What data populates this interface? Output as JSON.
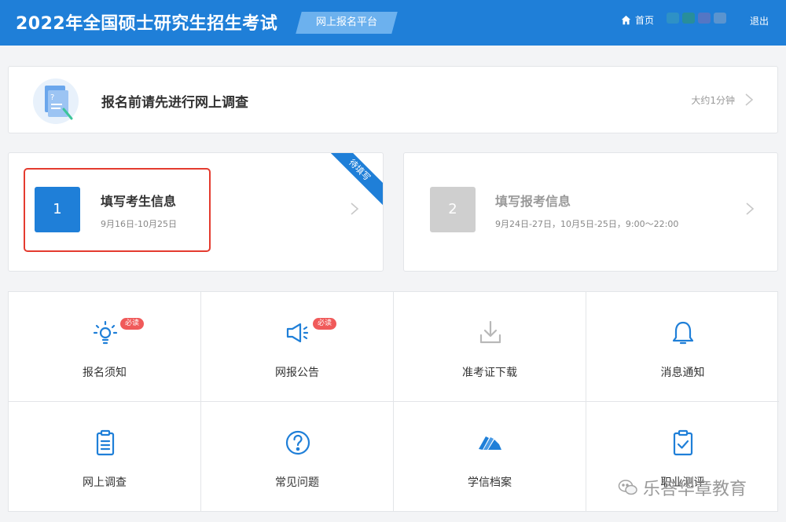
{
  "header": {
    "title": "2022年全国硕士研究生招生考试",
    "platform": "网上报名平台",
    "home_label": "首页",
    "logout_label": "退出",
    "blurred_colors": [
      "#3aa0b8",
      "#2f9a6a",
      "#7f6fb5",
      "#8aa5c8"
    ]
  },
  "survey": {
    "title": "报名前请先进行网上调查",
    "hint": "大约1分钟"
  },
  "steps": [
    {
      "number": "1",
      "title": "填写考生信息",
      "date": "9月16日-10月25日",
      "ribbon": "待填写",
      "color": "#1f7fd8"
    },
    {
      "number": "2",
      "title": "填写报考信息",
      "date": "9月24日-27日，10月5日-25日，9:00～22:00",
      "color": "#cfcfcf"
    }
  ],
  "tiles": [
    {
      "label": "报名须知",
      "icon": "lightbulb-icon",
      "badge": "必读"
    },
    {
      "label": "网报公告",
      "icon": "megaphone-icon",
      "badge": "必读"
    },
    {
      "label": "准考证下载",
      "icon": "download-icon"
    },
    {
      "label": "消息通知",
      "icon": "bell-icon"
    },
    {
      "label": "网上调查",
      "icon": "clipboard-icon"
    },
    {
      "label": "常见问题",
      "icon": "question-icon"
    },
    {
      "label": "学信档案",
      "icon": "archive-icon"
    },
    {
      "label": "职业测评",
      "icon": "assessment-icon"
    }
  ],
  "watermark": "乐答华章教育",
  "colors": {
    "primary": "#1f7fd8",
    "badge": "#f05a5a",
    "highlight": "#e43b2f"
  }
}
